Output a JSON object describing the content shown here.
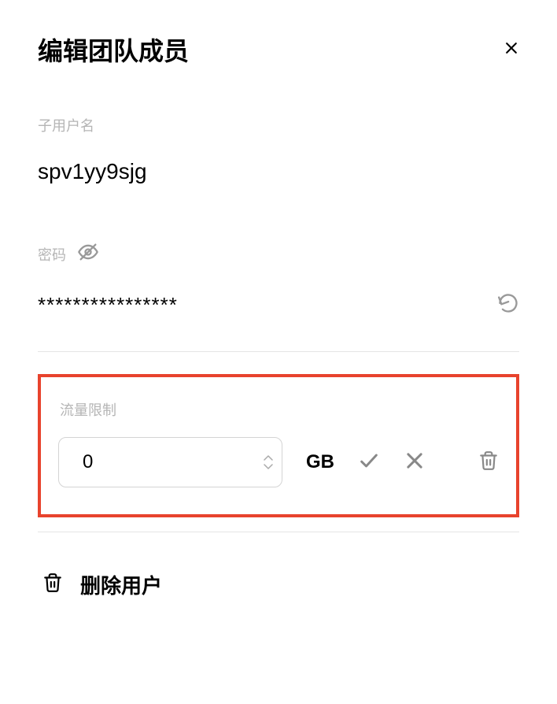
{
  "dialog": {
    "title": "编辑团队成员"
  },
  "username": {
    "label": "子用户名",
    "value": "spv1yy9sjg"
  },
  "password": {
    "label": "密码",
    "value": "****************"
  },
  "traffic": {
    "label": "流量限制",
    "value": "0",
    "unit": "GB"
  },
  "actions": {
    "delete_user": "删除用户"
  }
}
